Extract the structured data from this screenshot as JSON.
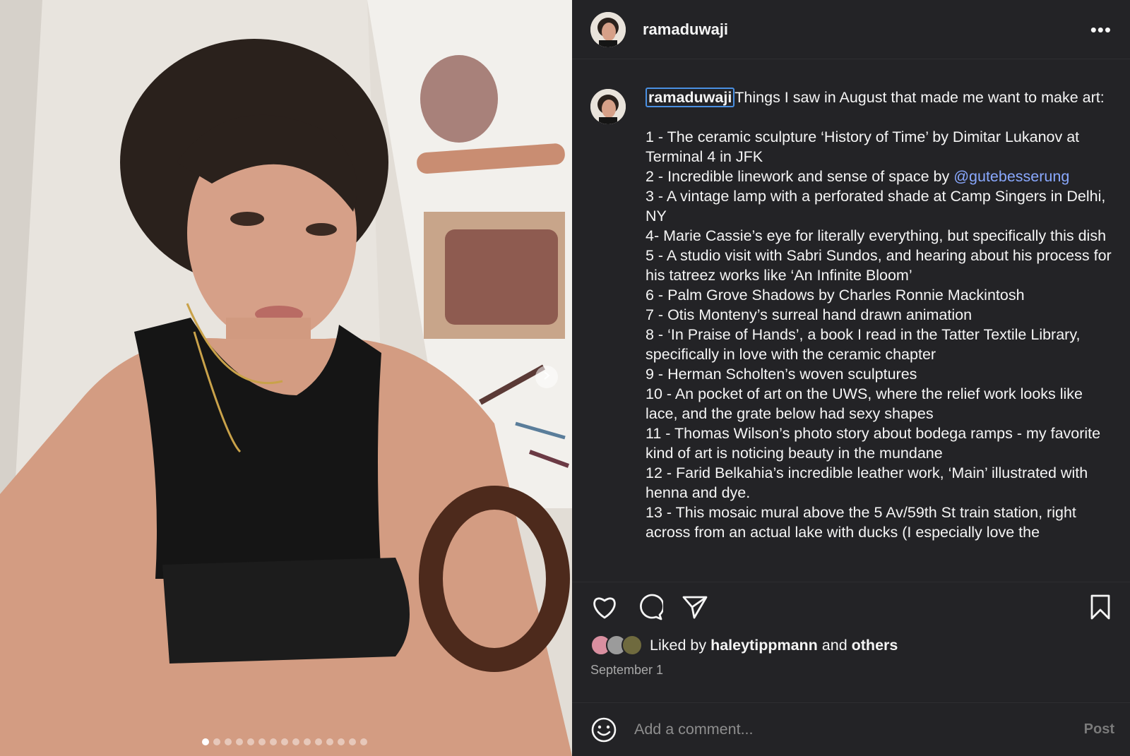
{
  "post": {
    "username": "ramaduwaji",
    "more_label": "•••",
    "photo_dots_total": 15,
    "photo_dots_active_index": 0
  },
  "caption": {
    "username": "ramaduwaji",
    "intro": "Things I saw in August that made me want to make art:",
    "items": [
      "1 - The ceramic sculpture ‘History of Time’ by Dimitar Lukanov at Terminal 4 in JFK",
      "2 - Incredible linework and sense of space by ",
      "3 - A vintage lamp with a perforated shade at Camp Singers in Delhi, NY",
      "4- Marie Cassie’s eye for literally everything, but specifically this dish",
      "5 - A studio visit with Sabri Sundos, and hearing about his process for his tatreez works like ‘An Infinite Bloom’",
      "6 - Palm Grove Shadows by Charles Ronnie Mackintosh",
      "7 - Otis Monteny’s surreal hand drawn animation",
      "8 - ‘In Praise of Hands’, a book I read in the Tatter Textile Library, specifically in love with the ceramic chapter",
      "9 - Herman Scholten’s woven sculptures",
      "10 - An pocket of art on the UWS, where the relief work looks like lace, and the grate below had sexy shapes",
      "11 - Thomas Wilson’s photo story about bodega ramps - my favorite kind of art is noticing beauty in the mundane",
      "12 - Farid Belkahia’s incredible leather work, ‘Main’ illustrated with henna and dye.",
      "13 - This mosaic mural above the 5 Av/59th St train station, right across from an actual lake with ducks (I especially love the"
    ],
    "mention": "@gutebesserung"
  },
  "actions": {
    "like_icon": "heart-icon",
    "comment_icon": "comment-icon",
    "share_icon": "send-icon",
    "save_icon": "bookmark-icon"
  },
  "likes": {
    "prefix": "Liked by",
    "user": "haleytippmann",
    "joiner": "and",
    "others": "others"
  },
  "date": "September 1",
  "comment": {
    "placeholder": "Add a comment...",
    "post_label": "Post"
  },
  "colors": {
    "panel_bg": "#232326",
    "mention": "#8aa9ff",
    "highlight_border": "#4a90e2"
  }
}
